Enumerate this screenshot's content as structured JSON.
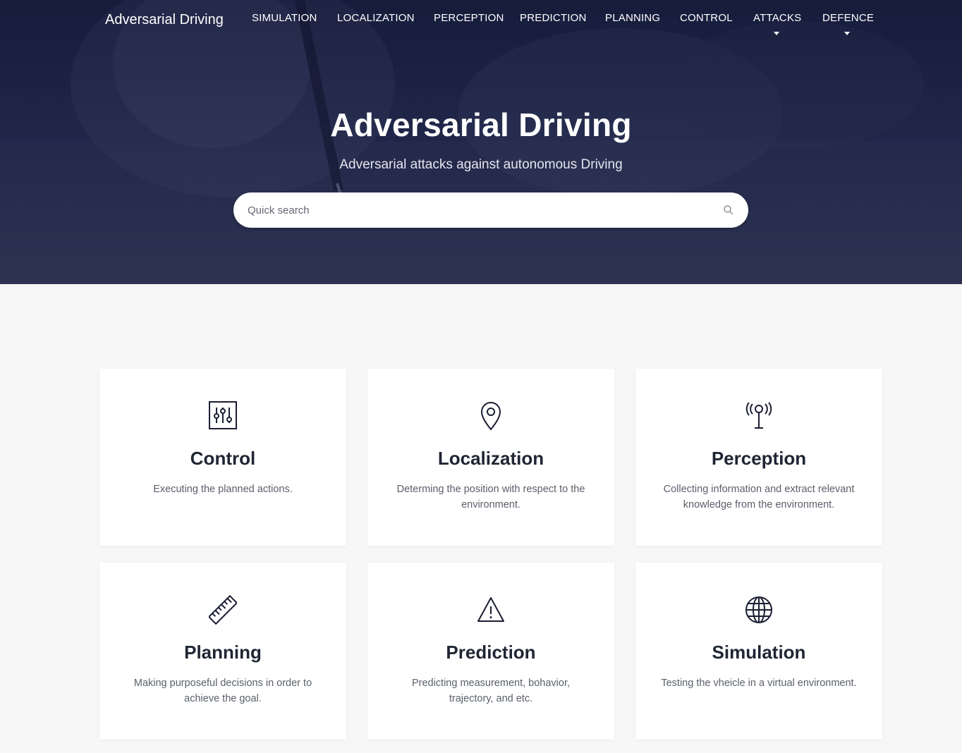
{
  "navbar": {
    "brand": "Adversarial Driving",
    "items": [
      {
        "label": "SIMULATION"
      },
      {
        "label": "LOCALIZATION"
      },
      {
        "label": "PERCEPTION"
      },
      {
        "label": "PREDICTION"
      },
      {
        "label": "PLANNING"
      },
      {
        "label": "CONTROL"
      },
      {
        "label": "ATTACKS",
        "dropdown": true
      },
      {
        "label": "DEFENCE",
        "dropdown": true
      }
    ]
  },
  "hero": {
    "title": "Adversarial Driving",
    "subtitle": "Adversarial attacks against autonomous Driving",
    "search_placeholder": "Quick search"
  },
  "cards": [
    {
      "title": "Control",
      "description": "Executing the planned actions.",
      "icon": "sliders-icon"
    },
    {
      "title": "Localization",
      "description": "Determing the position with respect to the environment.",
      "icon": "map-pin-icon"
    },
    {
      "title": "Perception",
      "description": "Collecting information and extract relevant knowledge from the environment.",
      "icon": "antenna-icon"
    },
    {
      "title": "Planning",
      "description": "Making purposeful decisions in order to achieve the goal.",
      "icon": "ruler-icon"
    },
    {
      "title": "Prediction",
      "description": "Predicting measurement, bohavior, trajectory, and etc.",
      "icon": "warning-icon"
    },
    {
      "title": "Simulation",
      "description": "Testing the vheicle in a virtual environment.",
      "icon": "globe-icon"
    }
  ],
  "colors": {
    "hero_bg": "#1d2344",
    "card_title": "#1f2533",
    "card_text": "#5a5f6a",
    "page_bg": "#f7f7f7"
  }
}
